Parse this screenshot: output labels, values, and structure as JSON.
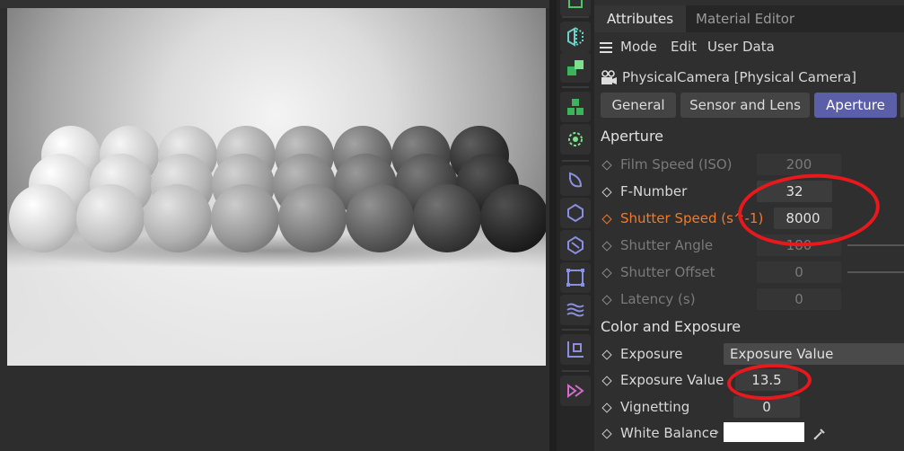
{
  "tabs": [
    "Attributes",
    "Material Editor"
  ],
  "menu": {
    "mode": "Mode",
    "edit": "Edit",
    "user_data": "User Data"
  },
  "object": {
    "name": "PhysicalCamera [Physical Camera]"
  },
  "pages": [
    "General",
    "Sensor and Lens",
    "Aperture"
  ],
  "aperture": {
    "title": "Aperture",
    "film_speed": {
      "label": "Film Speed (ISO)",
      "value": "200"
    },
    "f_number": {
      "label": "F-Number",
      "value": "32"
    },
    "shutter_speed": {
      "label": "Shutter Speed (s^-1)",
      "value": "8000"
    },
    "shutter_angle": {
      "label": "Shutter Angle",
      "value": "180"
    },
    "shutter_offset": {
      "label": "Shutter Offset",
      "value": "0"
    },
    "latency": {
      "label": "Latency (s)",
      "value": "0"
    }
  },
  "exposure": {
    "title": "Color and Exposure",
    "exposure": {
      "label": "Exposure",
      "value": "Exposure Value"
    },
    "exposure_value": {
      "label": "Exposure Value",
      "value": "13.5"
    },
    "vignetting": {
      "label": "Vignetting",
      "value": "0"
    },
    "white_balance": {
      "label": "White Balance"
    }
  },
  "colors": {
    "accent": "#5a5fa8",
    "highlight": "#f07a2a",
    "annotation": "#e8191d"
  },
  "icons": [
    "menu-icon",
    "camera-icon",
    "eyedropper-icon",
    "chevron-right-icon"
  ]
}
